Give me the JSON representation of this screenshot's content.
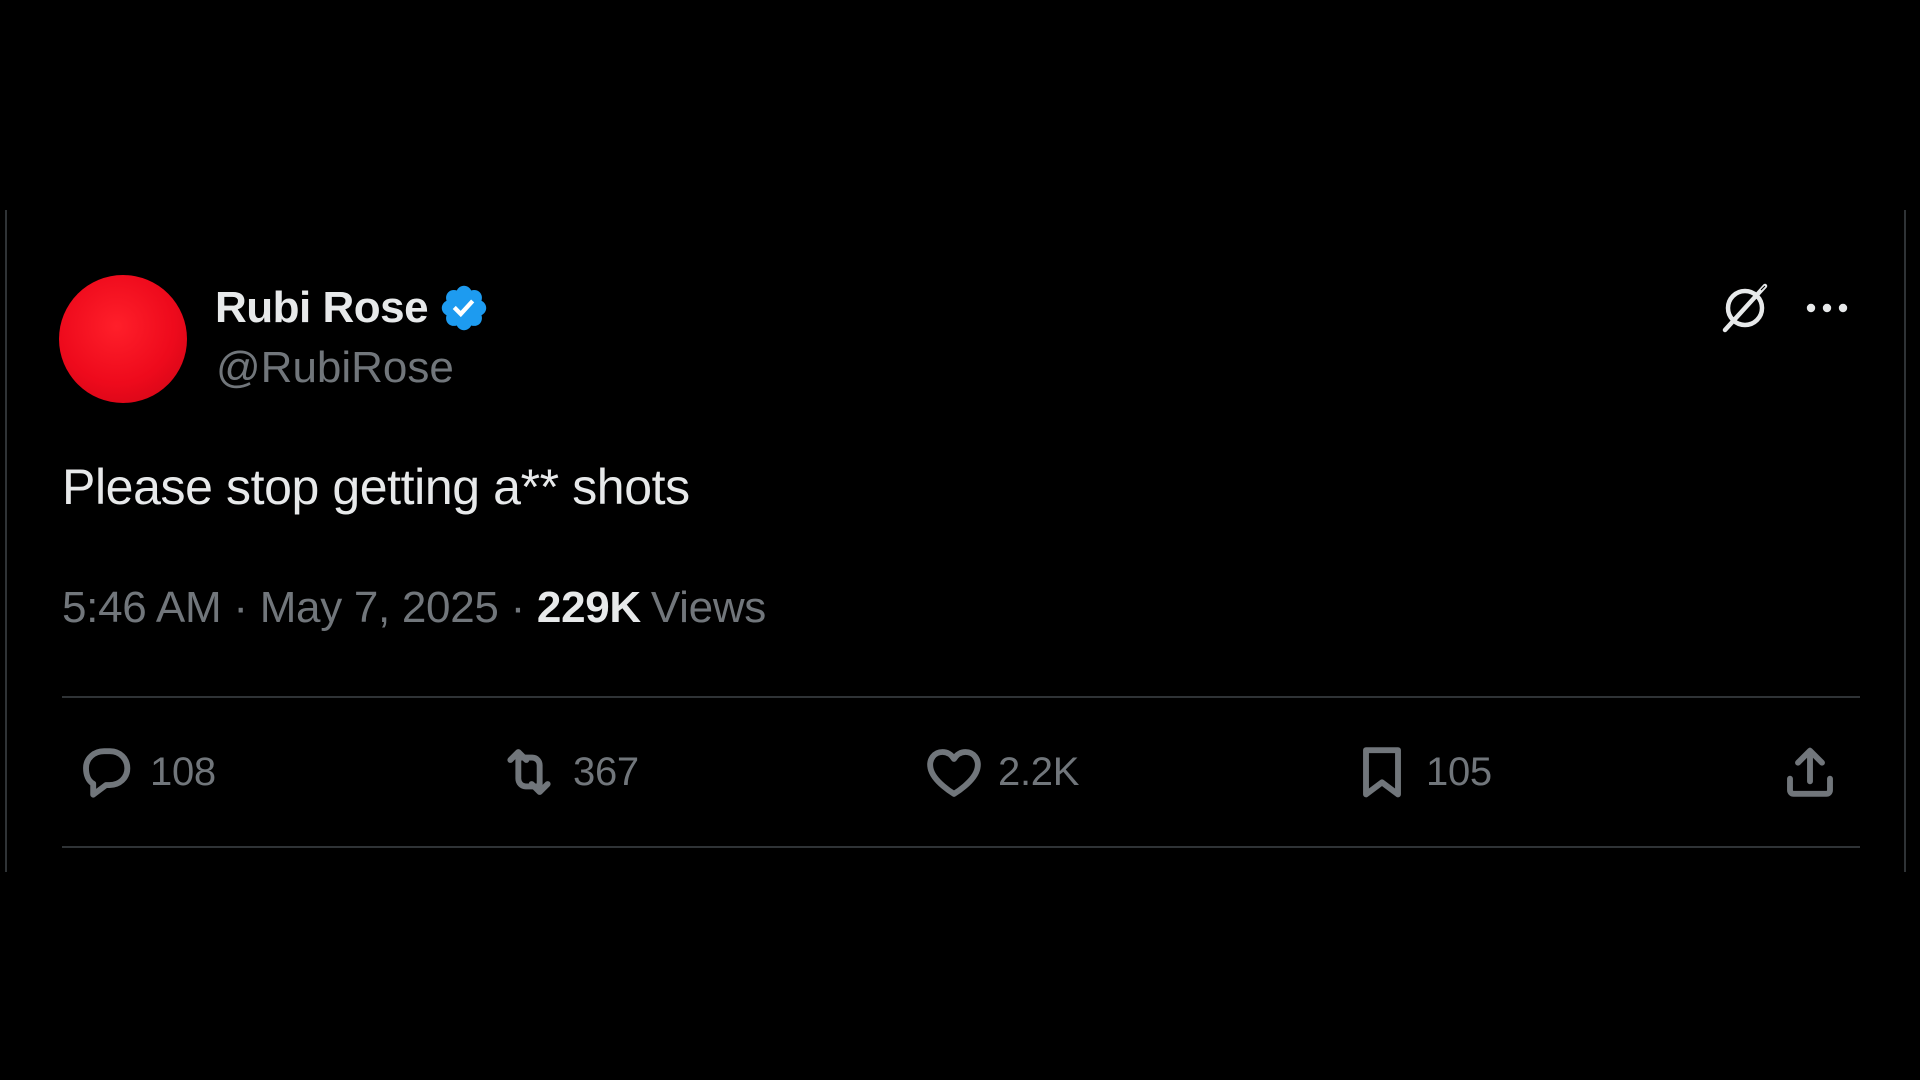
{
  "author": {
    "display_name": "Rubi Rose",
    "handle": "@RubiRose",
    "verified": true,
    "avatar_color": "#e8081a"
  },
  "tweet": {
    "text": "Please stop getting a** shots",
    "time": "5:46 AM",
    "date": "May 7, 2025",
    "views_count": "229K",
    "views_label": "Views"
  },
  "actions": {
    "replies": "108",
    "retweets": "367",
    "likes": "2.2K",
    "bookmarks": "105"
  },
  "icons": {
    "verified": "verified-badge-icon",
    "grok": "grok-icon",
    "more": "more-icon",
    "reply": "reply-icon",
    "retweet": "retweet-icon",
    "like": "heart-icon",
    "bookmark": "bookmark-icon",
    "share": "share-icon"
  },
  "colors": {
    "background": "#000000",
    "primary_text": "#e7e9ea",
    "secondary_text": "#71767b",
    "verified_blue": "#1d9bf0",
    "divider": "#2f3336"
  }
}
